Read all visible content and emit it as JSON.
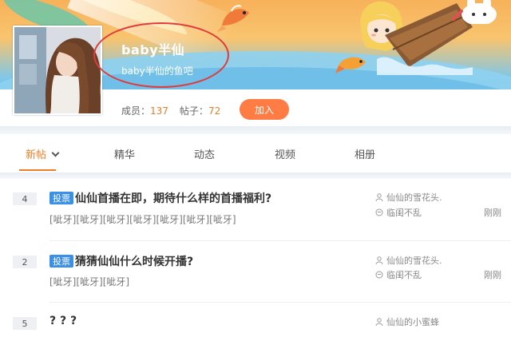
{
  "forum": {
    "name": "baby半仙",
    "subtitle": "baby半仙的鱼吧",
    "members_label": "成员：",
    "members_count": "137",
    "posts_label": "帖子：",
    "posts_count": "72",
    "join_label": "加入"
  },
  "tabs": [
    {
      "label": "新帖",
      "active": true
    },
    {
      "label": "精华"
    },
    {
      "label": "动态"
    },
    {
      "label": "视频"
    },
    {
      "label": "相册"
    }
  ],
  "threads": [
    {
      "count": "4",
      "badge": "投票",
      "title": "仙仙首播在即，期待什么样的首播福利?",
      "abstract": "[呲牙][呲牙][呲牙][呲牙][呲牙][呲牙][呲牙]",
      "author": "仙仙的雪花头.",
      "last_replier": "临闺不乱",
      "time": "刚刚"
    },
    {
      "count": "2",
      "badge": "投票",
      "title": "猜猜仙仙什么时候开播?",
      "abstract": "[呲牙][呲牙][呲牙]",
      "author": "仙仙的雪花头.",
      "last_replier": "临闺不乱",
      "time": "刚刚"
    },
    {
      "count": "5",
      "badge": "",
      "title": "? ? ?",
      "abstract": "",
      "author": "仙仙的小蜜蜂",
      "last_replier": "",
      "time": ""
    }
  ],
  "colors": {
    "accent": "#ef7d28",
    "join_button": "#ff7d45",
    "vote_badge": "#3a8fe6",
    "highlight_circle": "#e23a3a"
  },
  "icons": {
    "user": "user-icon",
    "reply": "comment-icon"
  }
}
